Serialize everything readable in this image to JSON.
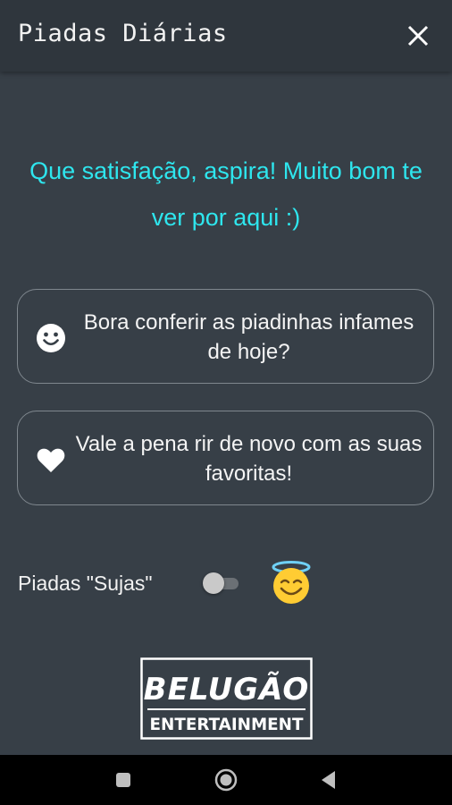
{
  "app_title": "Piadas Diárias",
  "greeting": "Que satisfação, aspira! Muito bom te ver por aqui :)",
  "buttons": {
    "today_label": "Bora conferir as piadinhas infames de hoje?",
    "today_icon": "smiley-face-icon",
    "favorites_label": "Vale a pena rir de novo com as suas favoritas!",
    "favorites_icon": "heart-icon"
  },
  "dirty_jokes": {
    "label": "Piadas \"Sujas\"",
    "enabled": false,
    "status_emoji": "smiling-face-with-halo"
  },
  "logo": {
    "top_text": "BELUGÃO",
    "bottom_text": "ENTERTAINMENT"
  },
  "colors": {
    "background": "#373f47",
    "appbar": "#2f363d",
    "accent": "#2ee6ee",
    "card_border": "#7f878e"
  },
  "navbar": {
    "icons": [
      "recents-square-icon",
      "home-circle-icon",
      "back-triangle-icon"
    ]
  }
}
